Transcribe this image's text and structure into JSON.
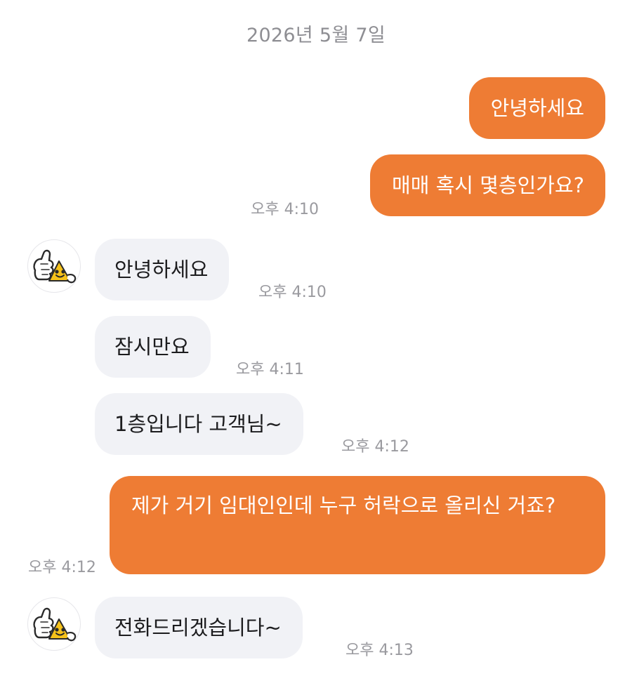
{
  "date_header": "2026년 5월 7일",
  "messages": [
    {
      "text": "안녕하세요"
    },
    {
      "text": "매매 혹시 몇층인가요?",
      "time": "오후 4:10"
    },
    {
      "text": "안녕하세요",
      "time": "오후 4:10"
    },
    {
      "text": "잠시만요",
      "time": "오후 4:11"
    },
    {
      "text": "1층입니다 고객님~",
      "time": "오후 4:12"
    },
    {
      "text": "제가 거기 임대인인데 누구 허락으로 올리신 거죠?",
      "time": "오후 4:12"
    },
    {
      "text": "전화드리겠습니다~",
      "time": "오후 4:13"
    }
  ],
  "colors": {
    "outgoing_bubble": "#ee7c34",
    "incoming_bubble": "#f1f2f6",
    "timestamp": "#9a9a9f"
  },
  "icons": {
    "avatar": "thumbs-up-star-mascot-icon"
  }
}
